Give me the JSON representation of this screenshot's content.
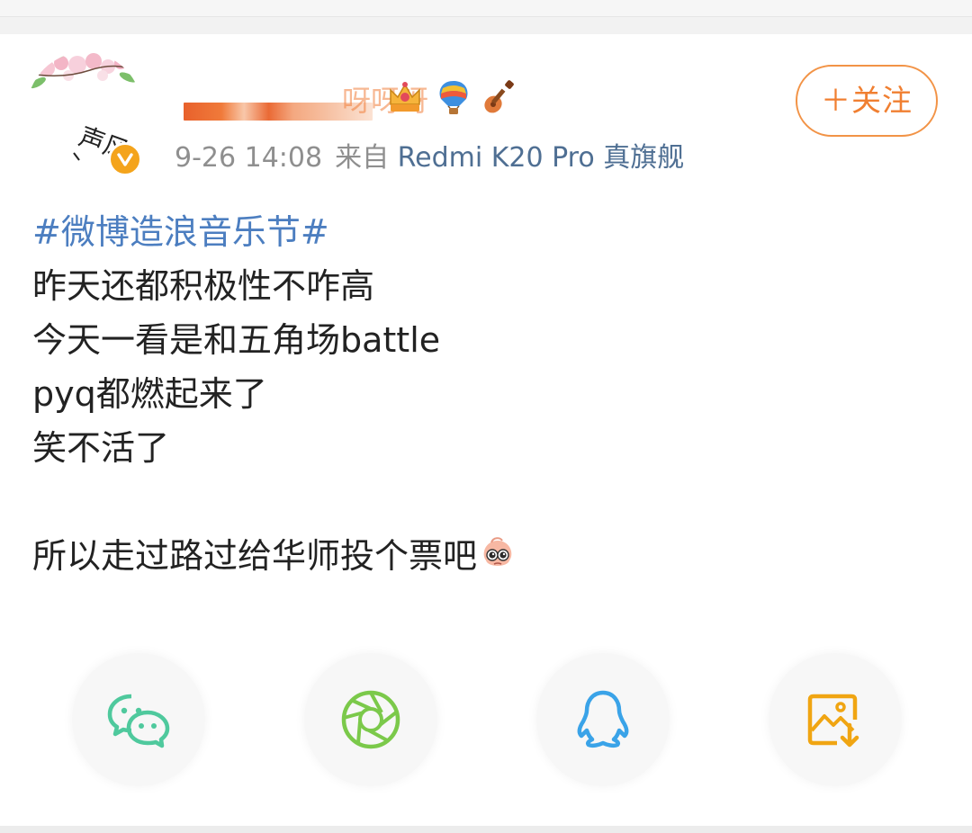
{
  "post": {
    "username_suffix": "呀呀呀",
    "timestamp": "9-26 14:08",
    "source_prefix": "来自",
    "device": "Redmi K20 Pro 真旗舰",
    "follow_label": "＋关注",
    "hashtag": "#微博造浪音乐节#",
    "lines": [
      "昨天还都积极性不咋高",
      "今天一看是和五角场battle",
      "pyq都燃起来了",
      "笑不活了"
    ],
    "closing_line": "所以走过路过给华师投个票吧",
    "avatar_text": "声风",
    "badges": [
      "crown-icon",
      "hot-air-balloon-icon",
      "guitar-icon"
    ],
    "inline_emoji": "pleading-face-emoji"
  },
  "share": {
    "items": [
      {
        "icon": "wechat-icon",
        "color": "#4fc99d"
      },
      {
        "icon": "moments-icon",
        "color": "#7bc94a"
      },
      {
        "icon": "qq-icon",
        "color": "#3aa3e8"
      },
      {
        "icon": "save-image-icon",
        "color": "#f0a512"
      }
    ]
  },
  "colors": {
    "accent_orange": "#f07f31",
    "link_blue": "#4c7ec0",
    "verify_gold": "#f4a41c"
  }
}
